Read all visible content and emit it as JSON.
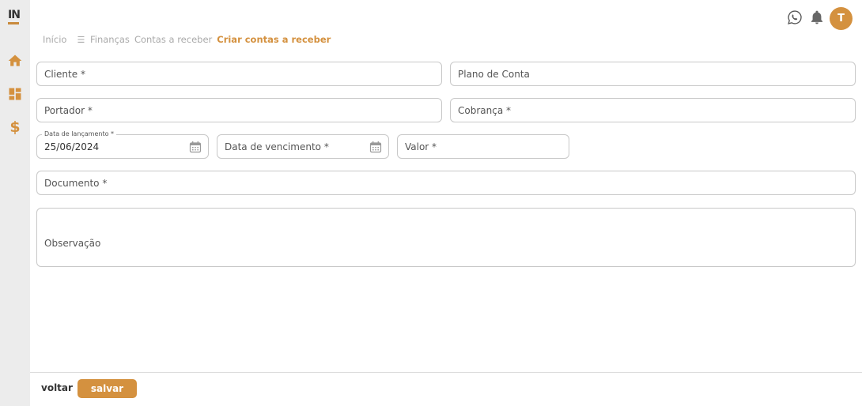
{
  "app": {
    "logo_text": "IN",
    "brand_color": "#d4913f"
  },
  "sidebar": {
    "items": [
      {
        "icon": "home-icon"
      },
      {
        "icon": "dashboard-icon"
      },
      {
        "icon": "dollar-icon",
        "glyph": "$"
      }
    ]
  },
  "topbar": {
    "icons": [
      "whatsapp-icon",
      "bell-icon"
    ],
    "avatar_initial": "T"
  },
  "breadcrumb": {
    "home": "Início",
    "finance": "Finanças",
    "receivables": "Contas a receber",
    "current": "Criar contas a receber"
  },
  "form": {
    "cliente": {
      "placeholder": "Cliente *"
    },
    "plano_de_conta": {
      "placeholder": "Plano de Conta"
    },
    "portador": {
      "placeholder": "Portador *"
    },
    "cobranca": {
      "placeholder": "Cobrança *"
    },
    "data_lancamento": {
      "label": "Data de lançamento *",
      "value": "25/06/2024"
    },
    "data_vencimento": {
      "placeholder": "Data de vencimento *"
    },
    "valor": {
      "placeholder": "Valor *"
    },
    "documento": {
      "placeholder": "Documento *"
    },
    "observacao": {
      "placeholder": "Observação"
    }
  },
  "footer": {
    "back_label": "voltar",
    "save_label": "salvar"
  }
}
